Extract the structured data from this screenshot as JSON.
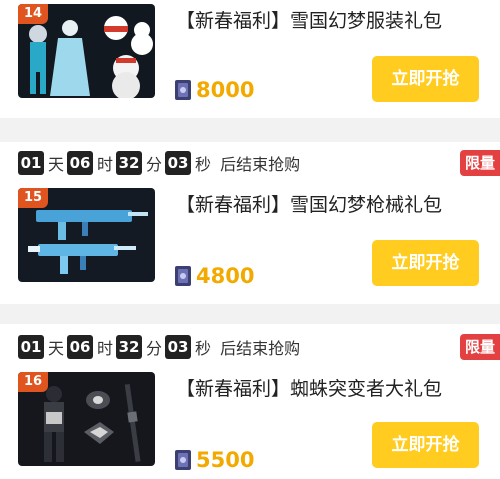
{
  "items": [
    {
      "index": "14",
      "title": "【新春福利】雪国幻梦服装礼包",
      "price": "8000",
      "buy_label": "立即开抢"
    },
    {
      "timer": {
        "days": "01",
        "day_unit": "天",
        "hours": "06",
        "hour_unit": "时",
        "minutes": "32",
        "minute_unit": "分",
        "seconds": "03",
        "second_unit": "秒",
        "suffix": "后结束抢购"
      },
      "badge": "限量",
      "index": "15",
      "title": "【新春福利】雪国幻梦枪械礼包",
      "price": "4800",
      "buy_label": "立即开抢"
    },
    {
      "timer": {
        "days": "01",
        "day_unit": "天",
        "hours": "06",
        "hour_unit": "时",
        "minutes": "32",
        "minute_unit": "分",
        "seconds": "03",
        "second_unit": "秒",
        "suffix": "后结束抢购"
      },
      "badge": "限量",
      "index": "16",
      "title": "【新春福利】蜘蛛突变者大礼包",
      "price": "5500",
      "buy_label": "立即开抢"
    }
  ],
  "colors": {
    "button": "#ffcc1f",
    "price": "#f2a900",
    "badge": "#e34141",
    "index_tag": "#e0541f",
    "timer_box": "#222222"
  },
  "icons": {
    "currency": "coupon-icon"
  }
}
